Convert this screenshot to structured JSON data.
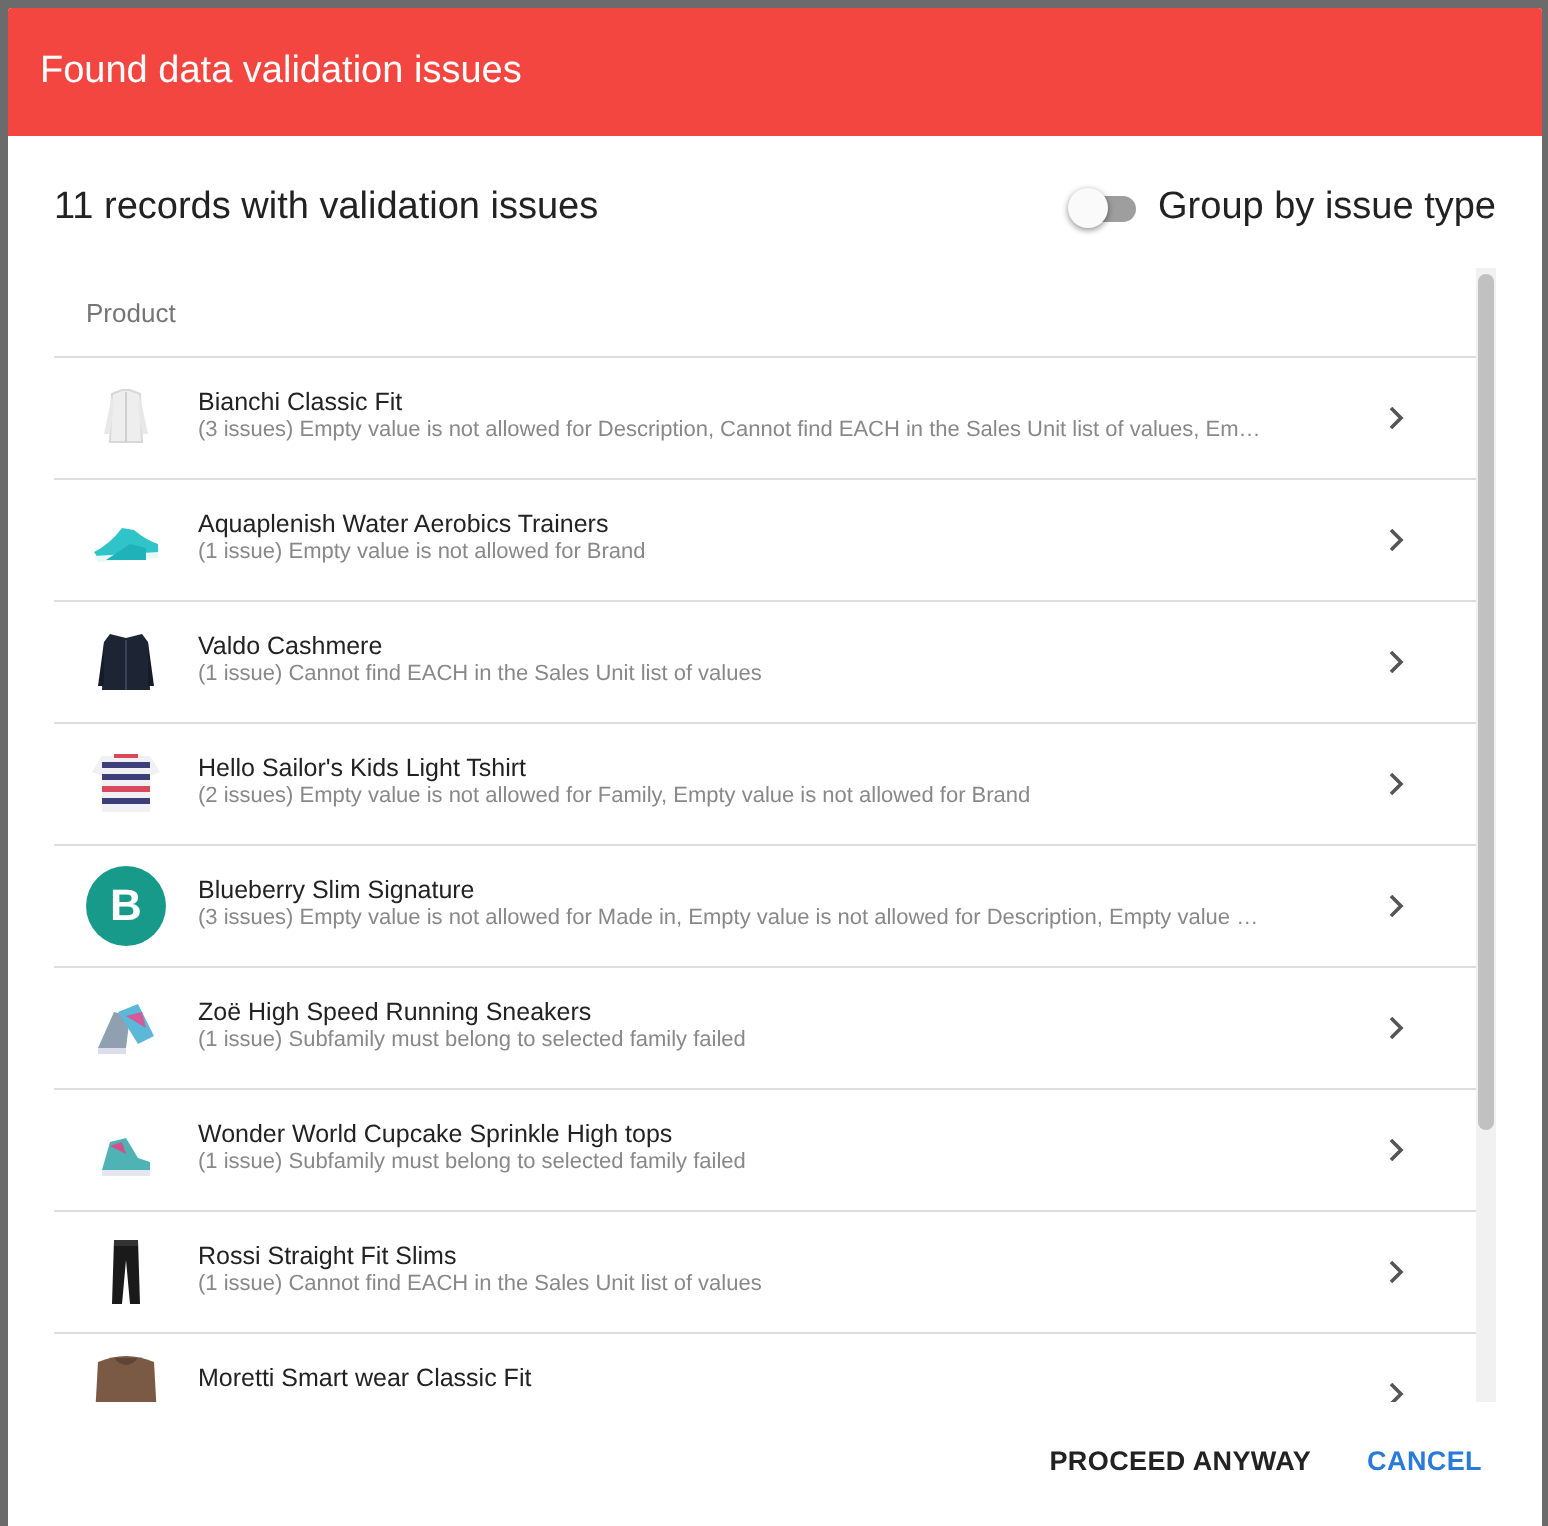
{
  "dialog": {
    "title": "Found data validation issues",
    "summary": "11 records with validation issues",
    "toggle": {
      "label": "Group by issue type",
      "on": false
    },
    "table": {
      "columns": [
        "Product"
      ],
      "rows": [
        {
          "name": "Bianchi Classic Fit",
          "issues": "(3 issues) Empty value is not allowed for Description, Cannot find EACH in the Sales Unit list of values, Em…"
        },
        {
          "name": "Aquaplenish Water Aerobics Trainers",
          "issues": "(1 issue) Empty value is not allowed for Brand"
        },
        {
          "name": "Valdo Cashmere",
          "issues": "(1 issue) Cannot find EACH in the Sales Unit list of values"
        },
        {
          "name": "Hello Sailor's Kids Light Tshirt",
          "issues": "(2 issues) Empty value is not allowed for Family, Empty value is not allowed for Brand"
        },
        {
          "thumb": {
            "kind": "avatar",
            "letter": "B",
            "color": "#179a8a"
          },
          "name": "Blueberry Slim Signature",
          "issues": "(3 issues) Empty value is not allowed for Made in, Empty value is not allowed for Description, Empty value …"
        },
        {
          "name": "Zoë High Speed Running Sneakers",
          "issues": "(1 issue) Subfamily must belong to selected family failed"
        },
        {
          "name": "Wonder World Cupcake Sprinkle High tops",
          "issues": "(1 issue) Subfamily must belong to selected family failed"
        },
        {
          "name": "Rossi Straight Fit Slims",
          "issues": "(1 issue) Cannot find EACH in the Sales Unit list of values"
        },
        {
          "name": "Moretti Smart wear Classic Fit"
        }
      ]
    },
    "buttons": [
      "PROCEED ANYWAY",
      "CANCEL"
    ]
  }
}
